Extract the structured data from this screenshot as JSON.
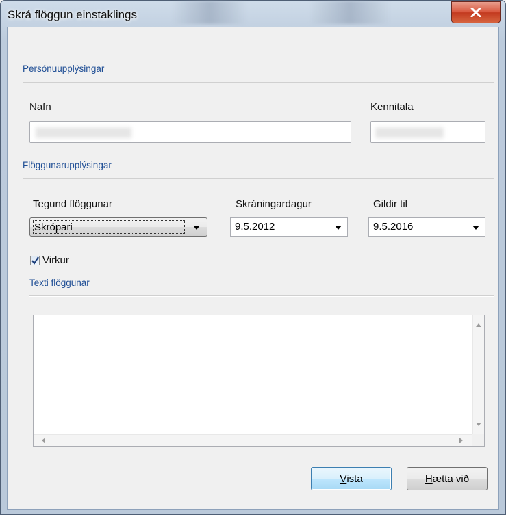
{
  "window": {
    "title": "Skrá flöggun einstaklings",
    "close_icon": "close-icon"
  },
  "personal": {
    "section_title": "Persónuupplýsingar",
    "name_label": "Nafn",
    "id_label": "Kennitala"
  },
  "flag": {
    "section_title": "Flöggunarupplýsingar",
    "type_label": "Tegund flöggunar",
    "type_value": "Skrópari",
    "registration_label": "Skráningardagur",
    "registration_value": "9.5.2012",
    "valid_until_label": "Gildir til",
    "valid_until_value": "9.5.2016",
    "active_label": "Virkur",
    "active_checked": true
  },
  "text": {
    "section_title": "Texti flöggunar",
    "value": ""
  },
  "buttons": {
    "save_first": "V",
    "save_rest": "ista",
    "cancel_first": "H",
    "cancel_rest": "ætta við"
  }
}
